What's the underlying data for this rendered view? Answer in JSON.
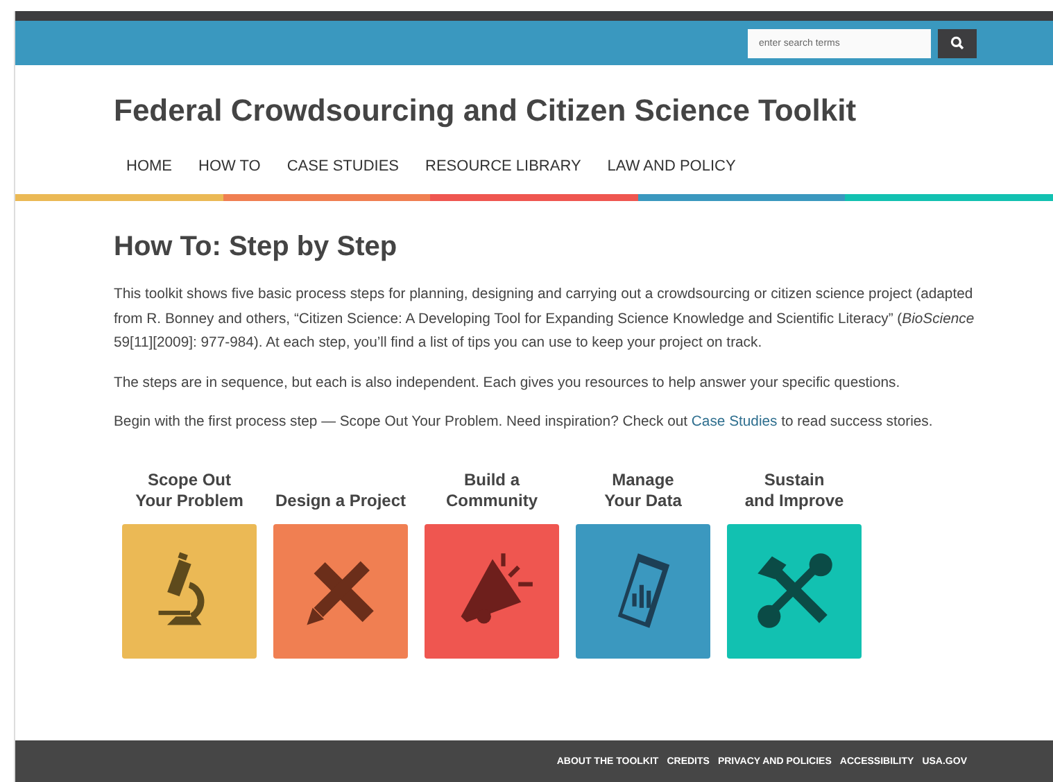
{
  "search": {
    "placeholder": "enter search terms"
  },
  "site_title": "Federal Crowdsourcing and Citizen Science Toolkit",
  "nav": [
    "HOME",
    "HOW TO",
    "CASE STUDIES",
    "RESOURCE LIBRARY",
    "LAW AND POLICY"
  ],
  "heading": "How To: Step by Step",
  "paragraphs": [
    {
      "text": "This toolkit shows five basic process steps for planning, designing and carrying out a crowdsourcing or citizen science project (adapted from R. Bonney and others, “Citizen Science: A Developing Tool for Expanding Science Knowledge and Scientific Literacy” (*BioScience* 59[11][2009]: 977-984). At each step, you’ll find a list of tips you can use to keep your project on track."
    },
    {
      "text": "The steps are in sequence, but each is also independent. Each gives you resources to help answer your specific questions."
    },
    {
      "text": "Begin with the first process step — Scope Out Your Problem. Need inspiration? Check out ",
      "link": "Case Studies",
      "after": " to read success stories."
    }
  ],
  "steps": [
    {
      "label": [
        "Scope Out",
        "Your Problem"
      ],
      "color": "#ebb955"
    },
    {
      "label": [
        "Design a Project"
      ],
      "color": "#f07f52"
    },
    {
      "label": [
        "Build a",
        "Community"
      ],
      "color": "#ef5650"
    },
    {
      "label": [
        "Manage",
        "Your Data"
      ],
      "color": "#3b98bf"
    },
    {
      "label": [
        "Sustain",
        "and Improve"
      ],
      "color": "#12c1b1"
    }
  ],
  "footer_links": [
    "ABOUT THE TOOLKIT",
    "CREDITS",
    "PRIVACY AND POLICIES",
    "ACCESSIBILITY",
    "USA.GOV"
  ]
}
